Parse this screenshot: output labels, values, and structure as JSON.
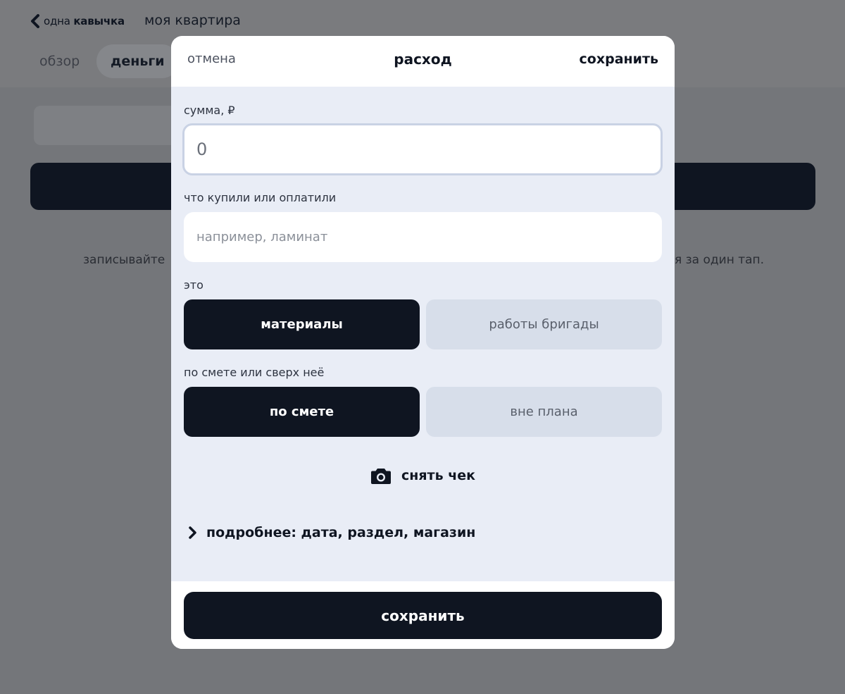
{
  "app": {
    "brand_prefix": "одна",
    "brand_bold": "кавычка",
    "title": "моя квартира",
    "tabs": [
      {
        "label": "обзор",
        "active": false
      },
      {
        "label": "деньги",
        "active": true
      }
    ],
    "hint_left": "записывайте",
    "hint_right": "я за один тап."
  },
  "modal": {
    "cancel_label": "отмена",
    "title": "расход",
    "save_label": "сохранить",
    "amount": {
      "label": "сумма, ₽",
      "value": "0"
    },
    "what": {
      "label": "что купили или оплатили",
      "placeholder": "например, ламинат",
      "value": ""
    },
    "type": {
      "label": "это",
      "options": [
        {
          "label": "материалы",
          "selected": true
        },
        {
          "label": "работы бригады",
          "selected": false
        }
      ]
    },
    "budget": {
      "label": "по смете или сверх неё",
      "options": [
        {
          "label": "по смете",
          "selected": true
        },
        {
          "label": "вне плана",
          "selected": false
        }
      ]
    },
    "receipt": {
      "label": "снять чек",
      "icon": "camera-icon"
    },
    "details": {
      "label": "подробнее: дата, раздел, магазин",
      "icon": "chevron-right-icon"
    },
    "footer_save_label": "сохранить"
  },
  "colors": {
    "primary": "#0f1521",
    "modal_bg": "#e9edf6",
    "segment_inactive": "#d7deea",
    "overlay_bg": "#74767a"
  }
}
